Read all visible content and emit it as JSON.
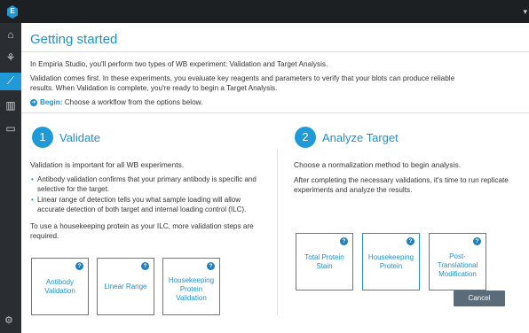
{
  "app": {
    "logo_letter": "E"
  },
  "page": {
    "title": "Getting started",
    "intro": "In Empiria Studio, you'll perform two types of WB experiment: Validation and Target Analysis.",
    "validation_line1": "Validation comes first. In these experiments, you evaluate key reagents and parameters to verify that your blots can produce reliable",
    "validation_line2": "results. When Validation is complete, you're ready to begin a Target Analysis.",
    "begin_label": "Begin:",
    "begin_text": " Choose a workflow from the options below."
  },
  "validate": {
    "number": "1",
    "title": "Validate",
    "lead": "Validation is important for all WB experiments.",
    "bullets": [
      {
        "l1": "Antibody validation confirms that your primary antibody is specific and",
        "l2": "selective for the target."
      },
      {
        "l1": "Linear range of detection tells you what sample loading will allow",
        "l2": "accurate detection of both target and internal loading control (ILC)."
      }
    ],
    "ilc_l1": "To use a housekeeping protein as your ILC, more validation steps are",
    "ilc_l2": "required.",
    "cards": [
      {
        "l1": "Antibody",
        "l2": "Validation",
        "l3": ""
      },
      {
        "l1": "Linear Range",
        "l2": "",
        "l3": ""
      },
      {
        "l1": "Housekeeping",
        "l2": "Protein",
        "l3": "Validation"
      }
    ]
  },
  "analyze": {
    "number": "2",
    "title": "Analyze Target",
    "lead": "Choose a normalization method to begin analysis.",
    "text_l1": "After completing the necessary validations, it's time to run replicate",
    "text_l2": "experiments and analyze the results.",
    "cards": [
      {
        "l1": "Total Protein",
        "l2": "Stain",
        "l3": ""
      },
      {
        "l1": "Housekeeping",
        "l2": "Protein",
        "l3": ""
      },
      {
        "l1": "Post-",
        "l2": "Translational",
        "l3": "Modification"
      }
    ]
  },
  "help_glyph": "?",
  "cancel_label": "Cancel",
  "colors": {
    "accent": "#1f8fcf",
    "topbar": "#1d2023",
    "sidebar": "#2a2e32",
    "cancel": "#5a6b7a"
  }
}
